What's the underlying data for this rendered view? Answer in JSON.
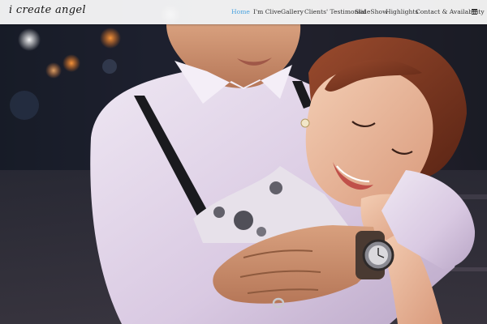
{
  "site": {
    "logo_text": "i create angel"
  },
  "nav": {
    "items": [
      {
        "label": "Home",
        "active": true
      },
      {
        "label": "I'm Clive",
        "active": false
      },
      {
        "label": "Gallery",
        "active": false
      },
      {
        "label": "Clients' Testimonial",
        "active": false
      },
      {
        "label": "SlideShow",
        "active": false
      },
      {
        "label": "Highlights",
        "active": false
      },
      {
        "label": "Contact & Availability",
        "active": false
      }
    ],
    "menu_icon": "hamburger-menu-icon",
    "active_color": "#4aa3df"
  },
  "hero": {
    "subject": "couple-embrace-photo"
  }
}
